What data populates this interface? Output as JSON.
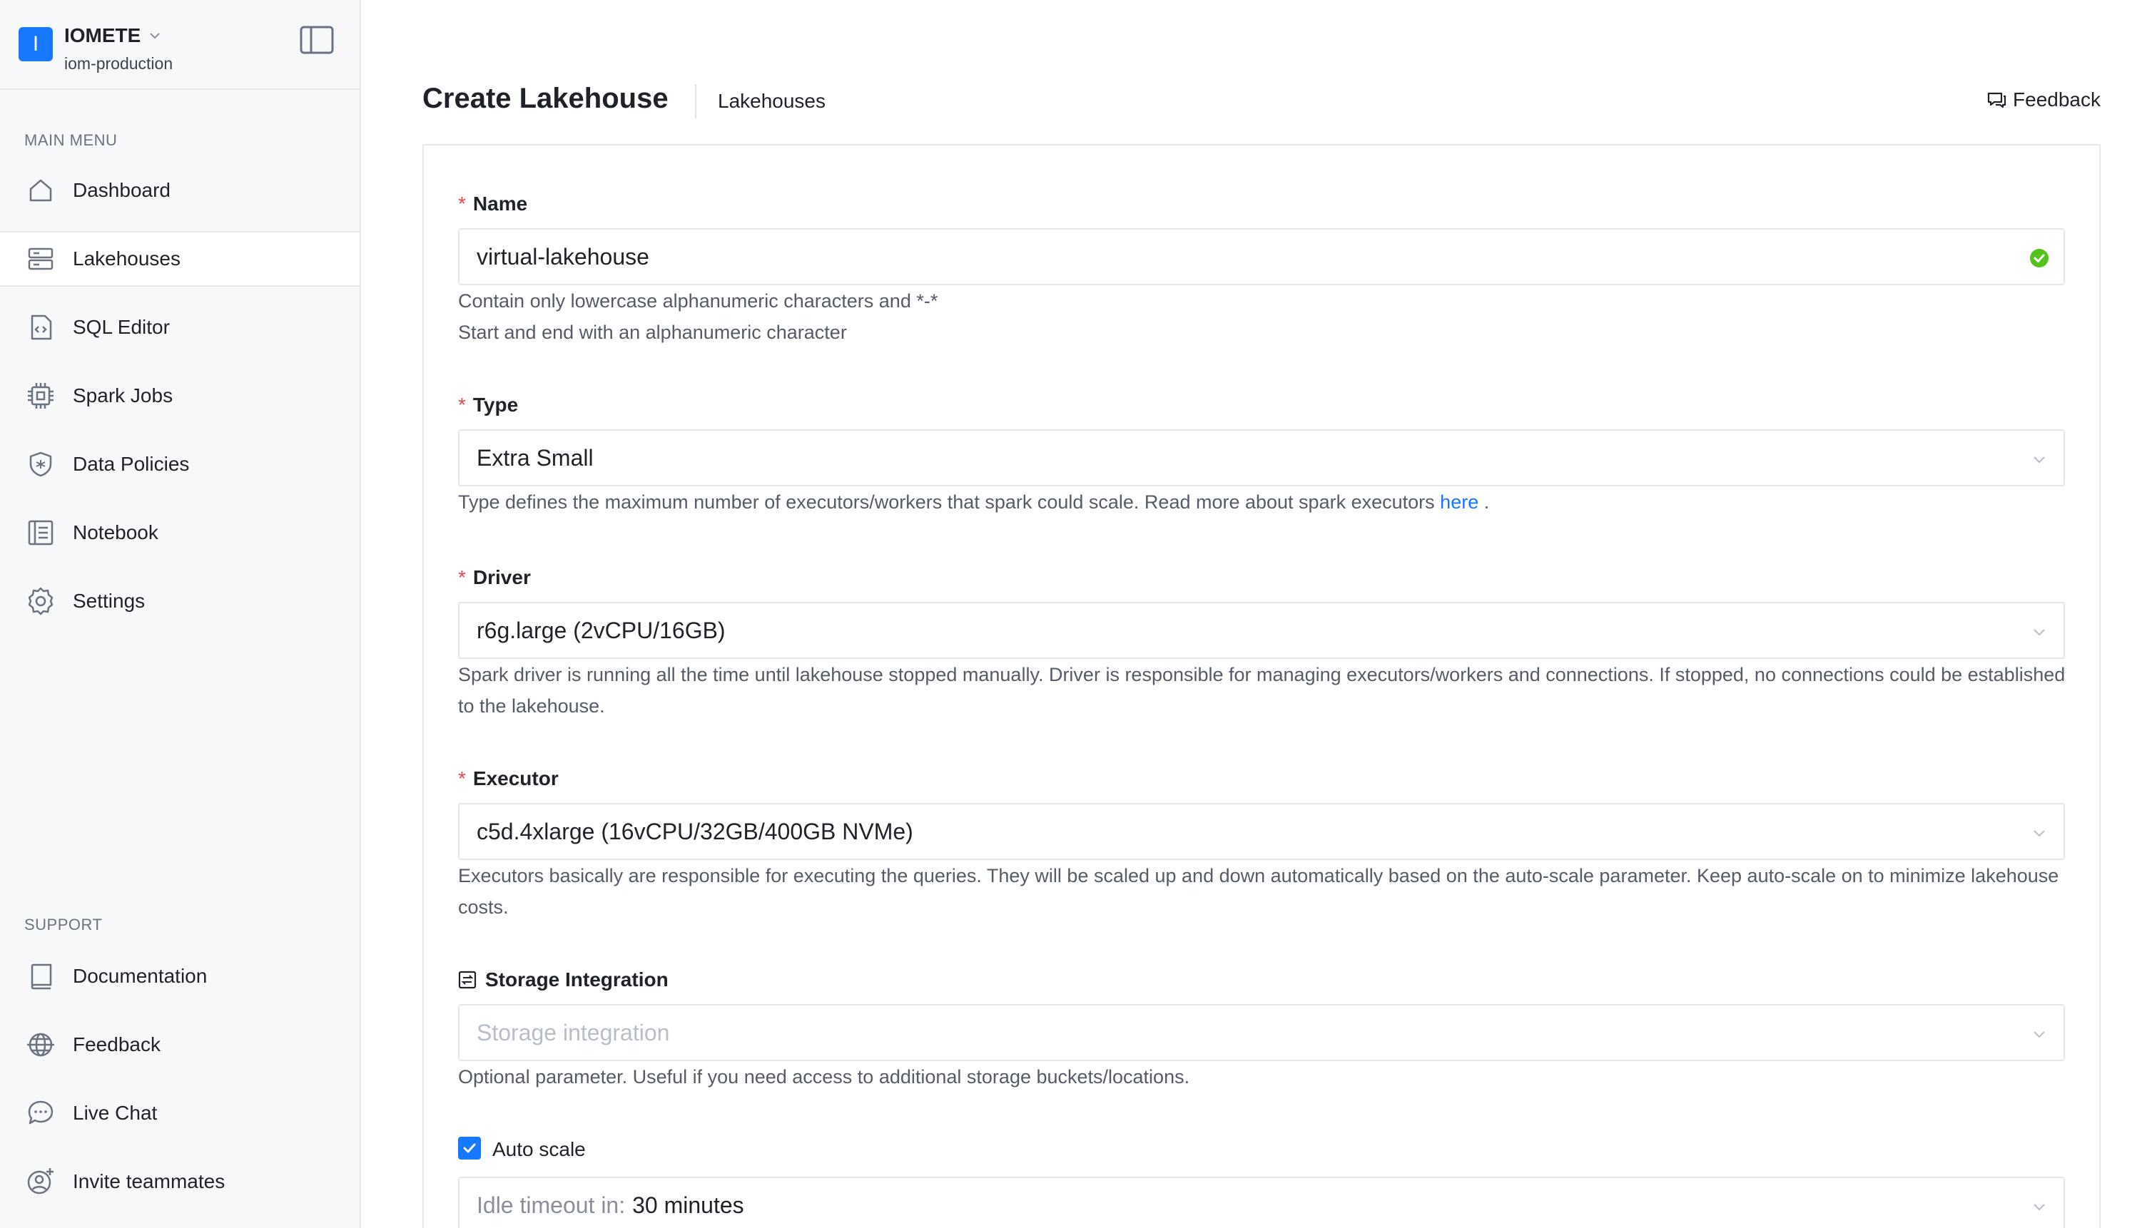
{
  "org": {
    "logo_letter": "I",
    "name": "IOMETE",
    "subtitle": "iom-production"
  },
  "sidebar": {
    "main_menu_label": "MAIN MENU",
    "main_items": [
      {
        "label": "Dashboard",
        "icon": "home-icon"
      },
      {
        "label": "Lakehouses",
        "icon": "server-icon",
        "active": true
      },
      {
        "label": "SQL Editor",
        "icon": "code-file-icon"
      },
      {
        "label": "Spark Jobs",
        "icon": "chip-icon"
      },
      {
        "label": "Data Policies",
        "icon": "shield-icon"
      },
      {
        "label": "Notebook",
        "icon": "notebook-icon"
      },
      {
        "label": "Settings",
        "icon": "gear-icon"
      }
    ],
    "support_label": "SUPPORT",
    "support_items": [
      {
        "label": "Documentation",
        "icon": "book-icon"
      },
      {
        "label": "Feedback",
        "icon": "globe-icon"
      },
      {
        "label": "Live Chat",
        "icon": "chat-icon"
      },
      {
        "label": "Invite teammates",
        "icon": "add-user-icon"
      }
    ]
  },
  "header": {
    "title": "Create Lakehouse",
    "breadcrumb": "Lakehouses",
    "feedback_label": "Feedback"
  },
  "form": {
    "name": {
      "label": "Name",
      "value": "virtual-lakehouse",
      "help_line1": "Contain only lowercase alphanumeric characters and *-*",
      "help_line2": "Start and end with an alphanumeric character"
    },
    "type": {
      "label": "Type",
      "value": "Extra Small",
      "help": "Type defines the maximum number of executors/workers that spark could scale. Read more about spark executors",
      "help_link": "here",
      "help_end": "."
    },
    "driver": {
      "label": "Driver",
      "value": "r6g.large (2vCPU/16GB)",
      "help": "Spark driver is running all the time until lakehouse stopped manually. Driver is responsible for managing executors/workers and connections. If stopped, no connections could be established to the lakehouse."
    },
    "executor": {
      "label": "Executor",
      "value": "c5d.4xlarge (16vCPU/32GB/400GB NVMe)",
      "help": "Executors basically are responsible for executing the queries. They will be scaled up and down automatically based on the auto-scale parameter. Keep auto-scale on to minimize lakehouse costs."
    },
    "storage": {
      "label": "Storage Integration",
      "placeholder": "Storage integration",
      "help": "Optional parameter. Useful if you need access to additional storage buckets/locations."
    },
    "autoscale": {
      "label": "Auto scale",
      "checked": true,
      "idle_prefix": "Idle timeout in:",
      "idle_value": "30 minutes"
    }
  },
  "colors": {
    "accent": "#1677ff",
    "required": "#e5484d",
    "success": "#52c41a"
  }
}
